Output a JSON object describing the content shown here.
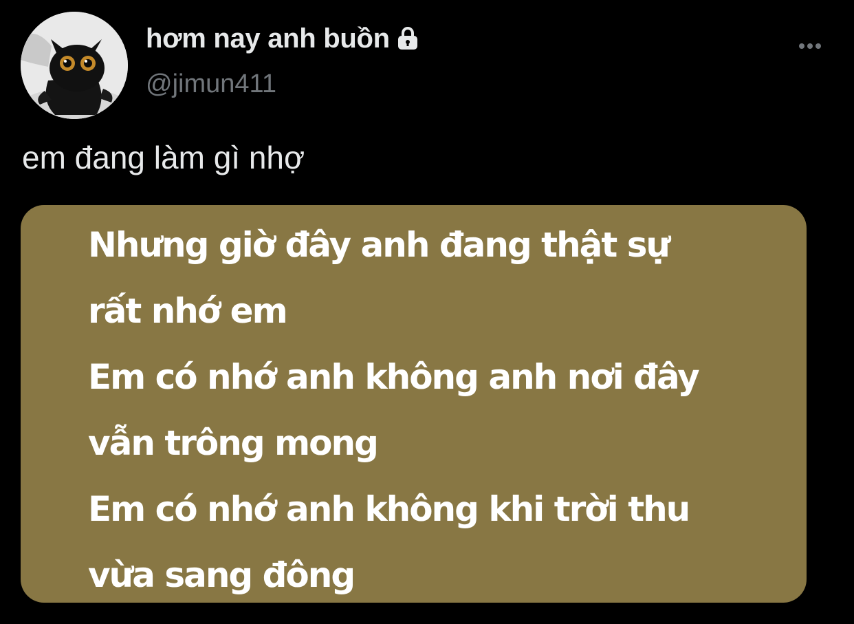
{
  "user": {
    "display_name": "hơm nay anh buồn",
    "handle": "@jimun411",
    "protected_icon": "lock-icon",
    "avatar_icon": "avatar-photo-wet-cat"
  },
  "actions": {
    "more_icon": "more-horizontal-icon"
  },
  "tweet": {
    "text": "em đang làm gì nhợ"
  },
  "media": {
    "background_color": "#887744",
    "lines": [
      "Nhưng giờ đây anh đang thật sự",
      "rất nhớ em",
      "Em có nhớ anh không anh nơi đây",
      "vẫn trông mong",
      "Em có nhớ anh không khi trời thu",
      "vừa sang đông"
    ]
  },
  "colors": {
    "background": "#000000",
    "primary_text": "#e7e9ea",
    "secondary_text": "#71767b",
    "lyric_text": "#ffffff"
  }
}
